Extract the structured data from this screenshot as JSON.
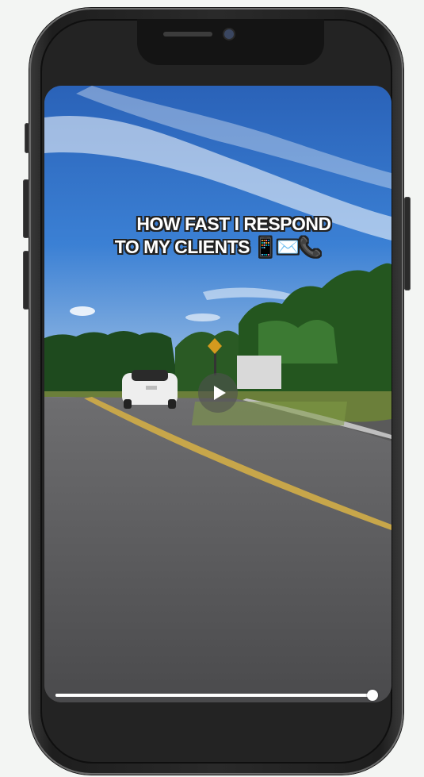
{
  "video": {
    "caption_line1": "HOW FAST I RESPOND",
    "caption_line2": "TO MY CLIENTS 📱✉️📞",
    "progress_fraction": 1.0
  },
  "colors": {
    "page_background": "#f3f5f3",
    "phone_frame": "#2a2a2a",
    "sky": "#2f6fc4",
    "road": "#5a5a5c"
  },
  "icons": [
    "play-icon"
  ]
}
